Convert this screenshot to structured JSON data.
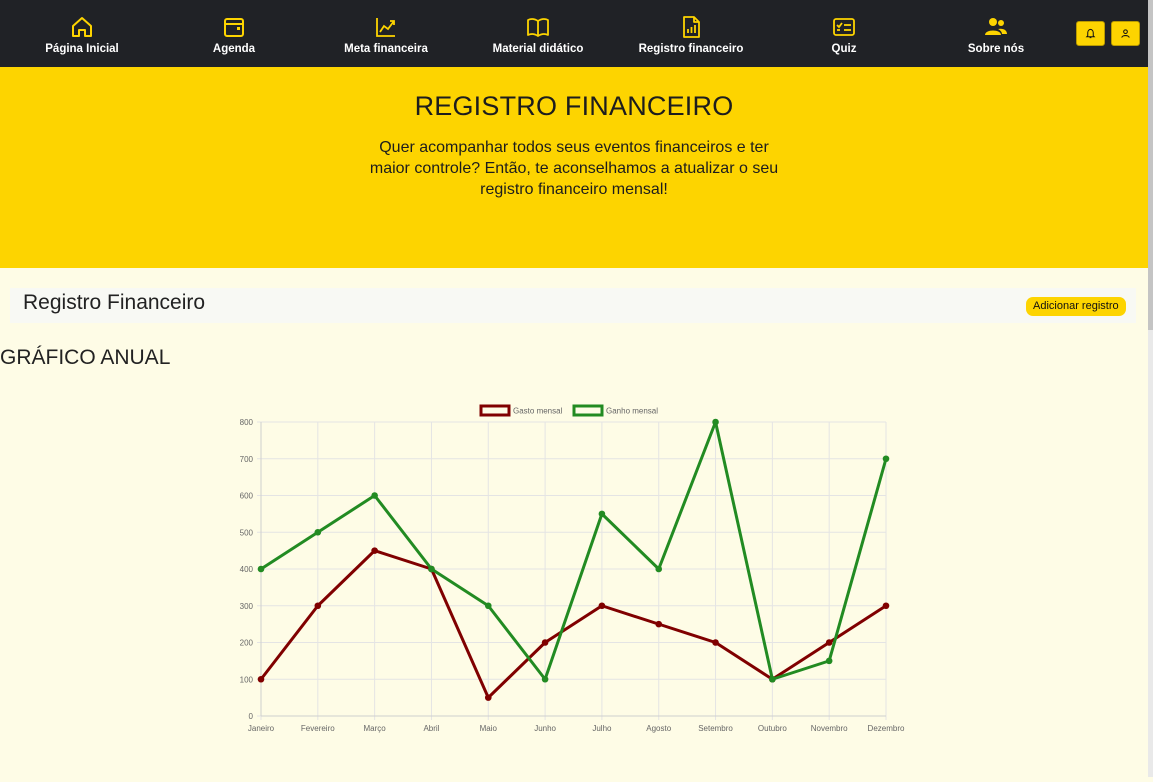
{
  "nav": {
    "items": [
      {
        "label": "Página Inicial",
        "icon": "home-icon"
      },
      {
        "label": "Agenda",
        "icon": "calendar-icon"
      },
      {
        "label": "Meta financeira",
        "icon": "trending-up-icon"
      },
      {
        "label": "Material didático",
        "icon": "book-icon"
      },
      {
        "label": "Registro financeiro",
        "icon": "file-chart-icon"
      },
      {
        "label": "Quiz",
        "icon": "quiz-card-icon"
      },
      {
        "label": "Sobre nós",
        "icon": "people-icon"
      }
    ],
    "bell_icon": "bell-icon",
    "user_icon": "user-icon",
    "accent": "#fdd400",
    "background": "#202226"
  },
  "hero": {
    "title": "REGISTRO FINANCEIRO",
    "subtitle": "Quer acompanhar todos seus eventos financeiros e ter maior controle? Então, te aconselhamos a atualizar o seu registro financeiro mensal!",
    "background": "#fdd400"
  },
  "registro": {
    "title": "Registro Financeiro",
    "add_button": "Adicionar registro"
  },
  "annual": {
    "title": "GRÁFICO ANUAL"
  },
  "chart_data": {
    "type": "line",
    "categories": [
      "Janeiro",
      "Fevereiro",
      "Março",
      "Abril",
      "Maio",
      "Junho",
      "Julho",
      "Agosto",
      "Setembro",
      "Outubro",
      "Novembro",
      "Dezembro"
    ],
    "series": [
      {
        "name": "Gasto mensal",
        "color": "#800000",
        "values": [
          100,
          300,
          450,
          400,
          50,
          200,
          300,
          250,
          200,
          100,
          200,
          300
        ]
      },
      {
        "name": "Ganho mensal",
        "color": "#228b22",
        "values": [
          400,
          500,
          600,
          400,
          300,
          100,
          550,
          400,
          800,
          100,
          150,
          700
        ]
      }
    ],
    "ylim": [
      0,
      800
    ],
    "yticks": [
      0,
      100,
      200,
      300,
      400,
      500,
      600,
      700,
      800
    ],
    "grid": true,
    "legend": "top"
  }
}
